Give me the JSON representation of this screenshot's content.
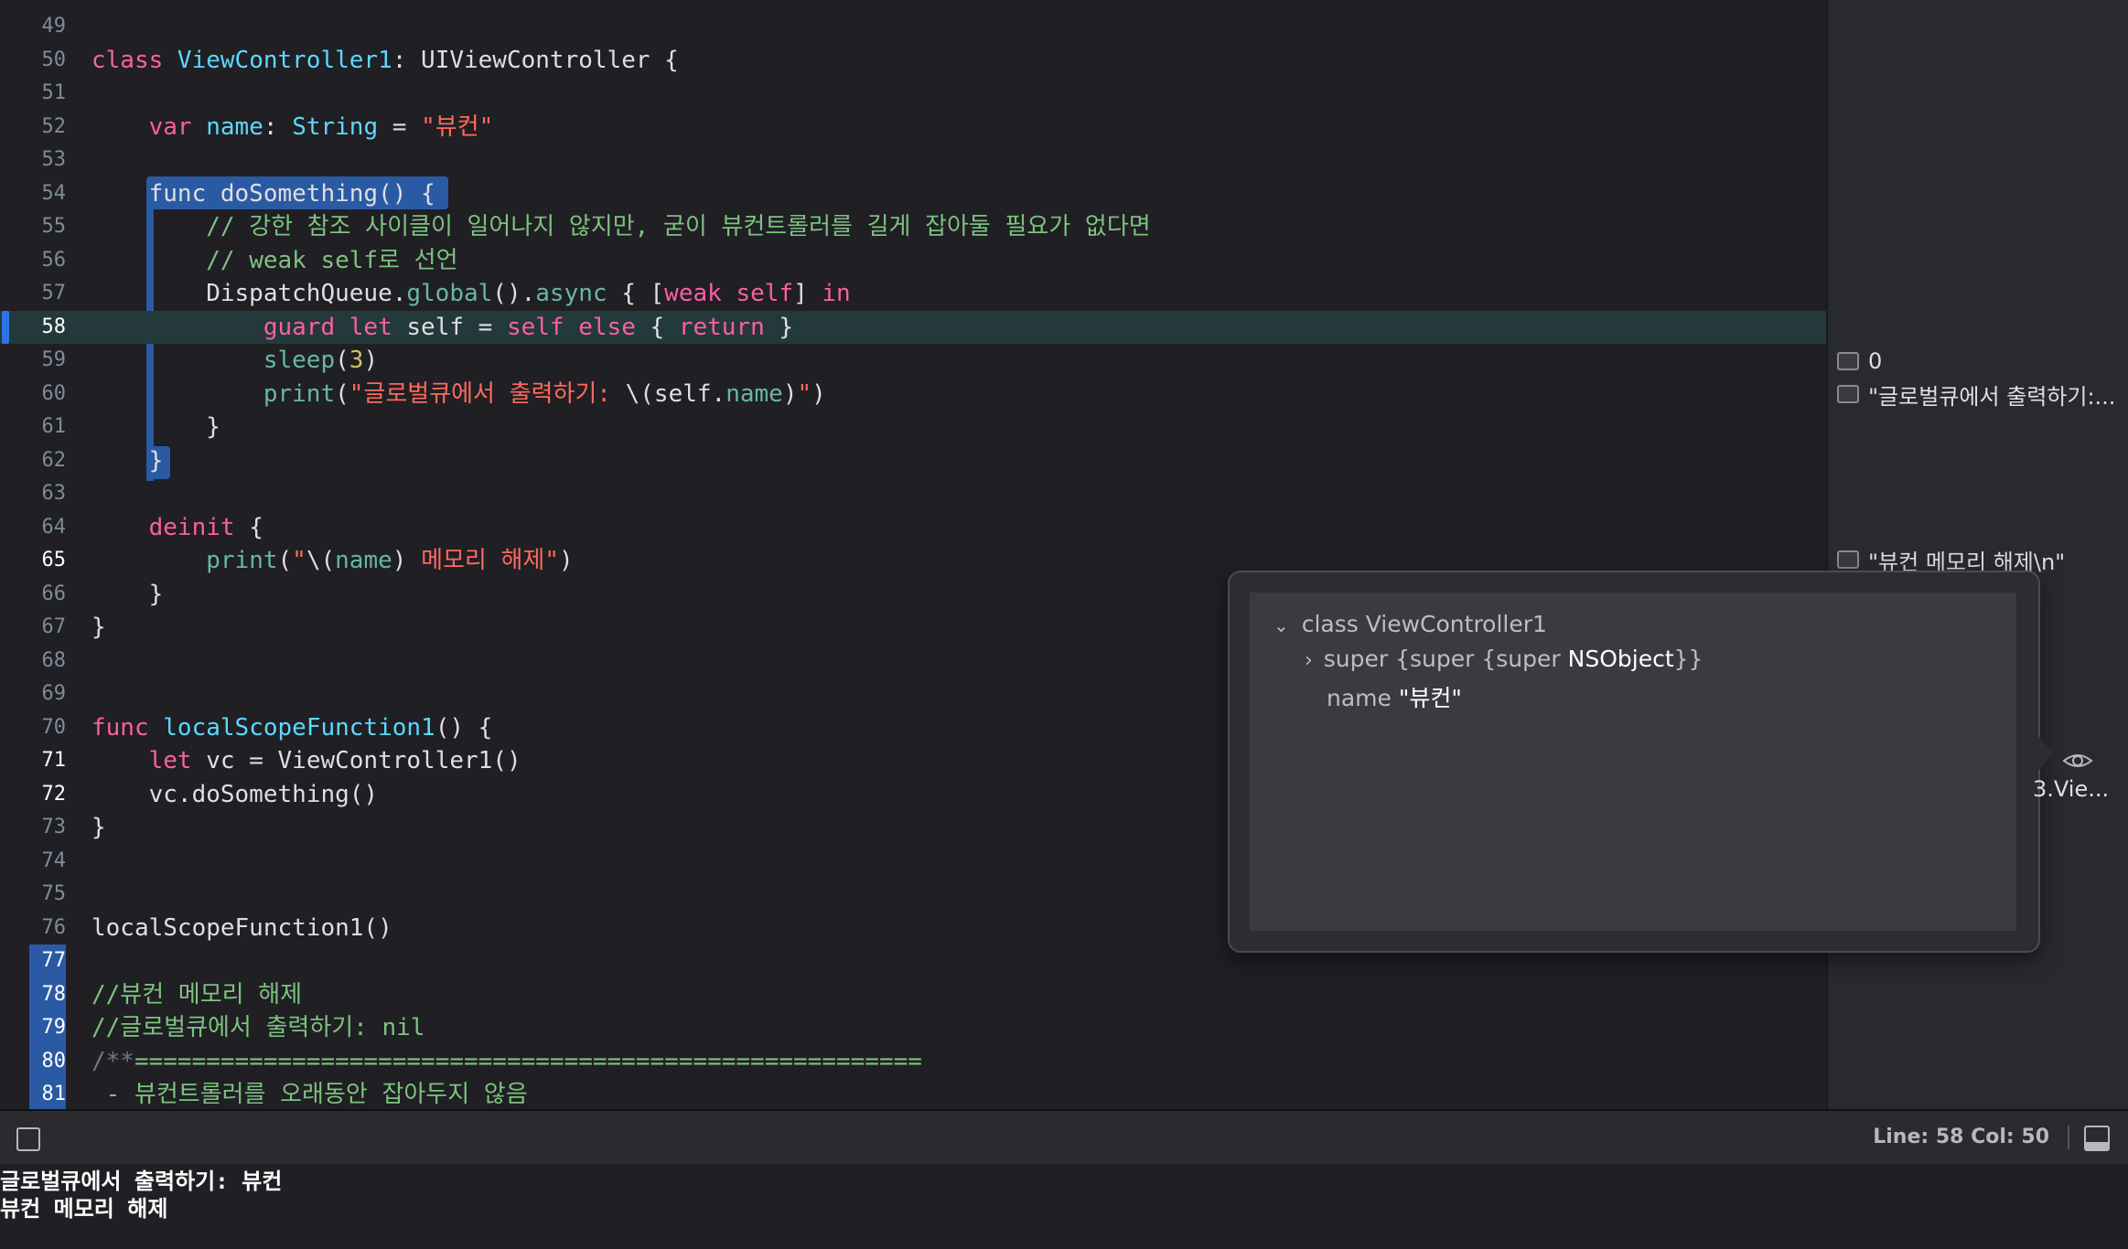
{
  "editor": {
    "lines": [
      {
        "n": "49",
        "tokens": []
      },
      {
        "n": "50",
        "tokens": [
          [
            "kw",
            "class "
          ],
          [
            "ty",
            "ViewController1"
          ],
          [
            "plain",
            ": UIViewController {"
          ]
        ]
      },
      {
        "n": "51",
        "tokens": []
      },
      {
        "n": "52",
        "tokens": [
          [
            "plain",
            "    "
          ],
          [
            "kw",
            "var "
          ],
          [
            "ty",
            "name"
          ],
          [
            "plain",
            ": "
          ],
          [
            "ty",
            "String"
          ],
          [
            "plain",
            " = "
          ],
          [
            "str",
            "\"뷰컨\""
          ]
        ]
      },
      {
        "n": "53",
        "tokens": []
      },
      {
        "n": "54",
        "tokens": [
          [
            "plain",
            "    func doSomething() {"
          ]
        ]
      },
      {
        "n": "55",
        "tokens": [
          [
            "plain",
            "        "
          ],
          [
            "cm2",
            "// 강한 참조 사이클이 일어나지 않지만, 굳이 뷰컨트롤러를 길게 잡아둘 필요가 없다면"
          ]
        ]
      },
      {
        "n": "56",
        "tokens": [
          [
            "plain",
            "        "
          ],
          [
            "cm2",
            "// weak self로 선언"
          ]
        ]
      },
      {
        "n": "57",
        "tokens": [
          [
            "plain",
            "        DispatchQueue."
          ],
          [
            "fn",
            "global"
          ],
          [
            "plain",
            "()."
          ],
          [
            "fn",
            "async"
          ],
          [
            "plain",
            " { ["
          ],
          [
            "kw",
            "weak self"
          ],
          [
            "plain",
            "] "
          ],
          [
            "kw",
            "in"
          ]
        ]
      },
      {
        "n": "58",
        "tokens": [
          [
            "plain",
            "            "
          ],
          [
            "kw",
            "guard let "
          ],
          [
            "plain",
            "self = "
          ],
          [
            "kw",
            "self else "
          ],
          [
            "plain",
            "{ "
          ],
          [
            "kw",
            "return"
          ],
          [
            "plain",
            " }"
          ]
        ]
      },
      {
        "n": "59",
        "tokens": [
          [
            "plain",
            "            "
          ],
          [
            "fn",
            "sleep"
          ],
          [
            "plain",
            "("
          ],
          [
            "num",
            "3"
          ],
          [
            "plain",
            ")"
          ]
        ]
      },
      {
        "n": "60",
        "tokens": [
          [
            "plain",
            "            "
          ],
          [
            "fn",
            "print"
          ],
          [
            "plain",
            "("
          ],
          [
            "str",
            "\"글로벌큐에서 출력하기: "
          ],
          [
            "plain",
            "\\(self."
          ],
          [
            "fn",
            "name"
          ],
          [
            "plain",
            ")"
          ],
          [
            "str",
            "\""
          ],
          [
            "plain",
            ")"
          ]
        ]
      },
      {
        "n": "61",
        "tokens": [
          [
            "plain",
            "        }"
          ]
        ]
      },
      {
        "n": "62",
        "tokens": [
          [
            "plain",
            "    }"
          ]
        ]
      },
      {
        "n": "63",
        "tokens": []
      },
      {
        "n": "64",
        "tokens": [
          [
            "plain",
            "    "
          ],
          [
            "kw",
            "deinit"
          ],
          [
            "plain",
            " {"
          ]
        ]
      },
      {
        "n": "65",
        "tokens": [
          [
            "plain",
            "        "
          ],
          [
            "fn",
            "print"
          ],
          [
            "plain",
            "("
          ],
          [
            "str",
            "\""
          ],
          [
            "plain",
            "\\("
          ],
          [
            "fn",
            "name"
          ],
          [
            "plain",
            ") "
          ],
          [
            "str",
            "메모리 해제\""
          ],
          [
            "plain",
            ")"
          ]
        ]
      },
      {
        "n": "66",
        "tokens": [
          [
            "plain",
            "    }"
          ]
        ]
      },
      {
        "n": "67",
        "tokens": [
          [
            "plain",
            "}"
          ]
        ]
      },
      {
        "n": "68",
        "tokens": []
      },
      {
        "n": "69",
        "tokens": []
      },
      {
        "n": "70",
        "tokens": [
          [
            "kw",
            "func "
          ],
          [
            "ty",
            "localScopeFunction1"
          ],
          [
            "plain",
            "() {"
          ]
        ]
      },
      {
        "n": "71",
        "tokens": [
          [
            "plain",
            "    "
          ],
          [
            "kw",
            "let "
          ],
          [
            "plain",
            "vc = ViewController1()"
          ]
        ]
      },
      {
        "n": "72",
        "tokens": [
          [
            "plain",
            "    vc.doSomething()"
          ]
        ]
      },
      {
        "n": "73",
        "tokens": [
          [
            "plain",
            "}"
          ]
        ]
      },
      {
        "n": "74",
        "tokens": []
      },
      {
        "n": "75",
        "tokens": []
      },
      {
        "n": "76",
        "tokens": [
          [
            "plain",
            "localScopeFunction1()"
          ]
        ]
      },
      {
        "n": "77",
        "tokens": []
      },
      {
        "n": "78",
        "tokens": [
          [
            "cm2",
            "//뷰컨 메모리 해제"
          ]
        ]
      },
      {
        "n": "79",
        "tokens": [
          [
            "cm2",
            "//글로벌큐에서 출력하기: nil"
          ]
        ]
      },
      {
        "n": "80",
        "tokens": [
          [
            "cm",
            "/**"
          ],
          [
            "cm2",
            "======================================================="
          ]
        ]
      },
      {
        "n": "81",
        "tokens": [
          [
            "cm2",
            " - 뷰컨트롤러를 오래동안 잡아두지 않음"
          ]
        ]
      }
    ]
  },
  "results": {
    "line59": "0",
    "line60": "\"글로벌큐에서 출력하기:...",
    "line65": "\"뷰컨 메모리 해제\\n\"",
    "partial": "3.Vie..."
  },
  "popover": {
    "class_label": "class ViewController1",
    "super_prefix": "super {super {super ",
    "super_obj": "NSObject",
    "super_suffix": "}}",
    "name_label": "name ",
    "name_value": "\"뷰컨\""
  },
  "status": {
    "position": "Line: 58  Col: 50"
  },
  "console": {
    "lines": [
      "글로벌큐에서 출력하기: 뷰컨",
      "뷰컨 메모리 해제"
    ]
  },
  "colors": {
    "keyword": "#fc5fa3",
    "type": "#5dd8ff",
    "function": "#67b7a4",
    "string": "#fc6a5d",
    "comment": "#7ec27e",
    "number": "#d0bf69",
    "scope_highlight": "#2b5aa5",
    "current_line": "#23393b"
  }
}
